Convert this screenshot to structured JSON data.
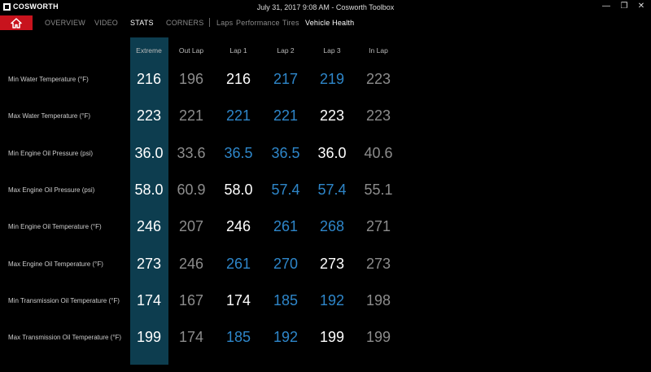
{
  "app": {
    "brand": "COSWORTH",
    "title": "July 31, 2017 9:08 AM - Cosworth Toolbox",
    "window_controls": {
      "minimize": "—",
      "restore": "❐",
      "close": "✕"
    }
  },
  "nav": {
    "home_icon": "home-icon",
    "tabs": [
      {
        "label": "OVERVIEW",
        "active": false
      },
      {
        "label": "VIDEO",
        "active": false
      },
      {
        "label": "STATS",
        "active": true
      },
      {
        "label": "CORNERS",
        "active": false
      }
    ],
    "subtabs": [
      {
        "label": "Laps",
        "active": false
      },
      {
        "label": "Performance",
        "active": false
      },
      {
        "label": "Tires",
        "active": false
      },
      {
        "label": "Vehicle Health",
        "active": true
      }
    ]
  },
  "colors": {
    "white": "#ffffff",
    "gray": "#8c8c8c",
    "blue": "#2e86c9",
    "extreme_bg": "#0d3d4f",
    "home_red": "#c8131d"
  },
  "table": {
    "columns": [
      "Extreme",
      "Out Lap",
      "Lap 1",
      "Lap 2",
      "Lap 3",
      "In Lap"
    ],
    "rows": [
      {
        "label": "Min Water Temperature (°F)",
        "values": [
          "216",
          "196",
          "216",
          "217",
          "219",
          "223"
        ],
        "colors": [
          "w",
          "g",
          "w",
          "b",
          "b",
          "g"
        ]
      },
      {
        "label": "Max Water Temperature (°F)",
        "values": [
          "223",
          "221",
          "221",
          "221",
          "223",
          "223"
        ],
        "colors": [
          "w",
          "g",
          "b",
          "b",
          "w",
          "g"
        ]
      },
      {
        "label": "Min Engine Oil Pressure (psi)",
        "values": [
          "36.0",
          "33.6",
          "36.5",
          "36.5",
          "36.0",
          "40.6"
        ],
        "colors": [
          "w",
          "g",
          "b",
          "b",
          "w",
          "g"
        ]
      },
      {
        "label": "Max Engine Oil Pressure (psi)",
        "values": [
          "58.0",
          "60.9",
          "58.0",
          "57.4",
          "57.4",
          "55.1"
        ],
        "colors": [
          "w",
          "g",
          "w",
          "b",
          "b",
          "g"
        ]
      },
      {
        "label": "Min Engine Oil Temperature (°F)",
        "values": [
          "246",
          "207",
          "246",
          "261",
          "268",
          "271"
        ],
        "colors": [
          "w",
          "g",
          "w",
          "b",
          "b",
          "g"
        ]
      },
      {
        "label": "Max Engine Oil Temperature (°F)",
        "values": [
          "273",
          "246",
          "261",
          "270",
          "273",
          "273"
        ],
        "colors": [
          "w",
          "g",
          "b",
          "b",
          "w",
          "g"
        ]
      },
      {
        "label": "Min Transmission Oil Temperature (°F)",
        "values": [
          "174",
          "167",
          "174",
          "185",
          "192",
          "198"
        ],
        "colors": [
          "w",
          "g",
          "w",
          "b",
          "b",
          "g"
        ]
      },
      {
        "label": "Max Transmission Oil Temperature (°F)",
        "values": [
          "199",
          "174",
          "185",
          "192",
          "199",
          "199"
        ],
        "colors": [
          "w",
          "g",
          "b",
          "b",
          "w",
          "g"
        ]
      }
    ]
  }
}
